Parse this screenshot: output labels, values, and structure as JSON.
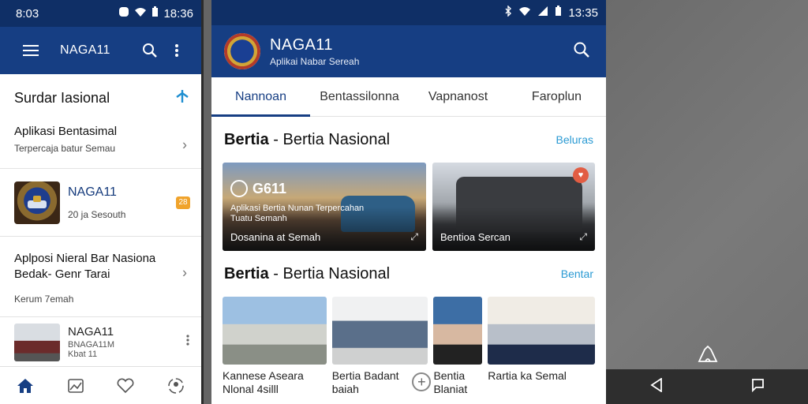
{
  "left": {
    "status_time": "8:03",
    "status_battery": "18:36",
    "app_title": "NAGA11",
    "section_title": "Surdar Iasional",
    "items": [
      {
        "title": "Aplikasi Bentasimal",
        "subtitle": "Terpercaja batur Semau"
      },
      {
        "title": "NAGA11",
        "subtitle": "20 ja Sesouth",
        "badge": "28"
      },
      {
        "title": "Aplposi Nieral Bar Nasiona Bedak- Genr Tarai",
        "subtitle": "Kerum 7emah"
      },
      {
        "title": "NAGA11",
        "line2": "BNAGA11M",
        "line3": "Kbat 11"
      }
    ]
  },
  "right": {
    "status_time": "13:35",
    "app_title": "NAGA11",
    "app_subtitle": "Aplikai Nabar Sereah",
    "tabs": [
      "Nannoan",
      "Bentassilonna",
      "Vapnanost",
      "Faroplun"
    ],
    "section1": {
      "bold": "Bertia",
      "rest": " - Bertia Nasional",
      "more": "Beluras"
    },
    "card1": {
      "logo": "G611",
      "subtitle": "Aplikasi Bertia Nunan Terpercahan Tuatu Semanh",
      "caption": "Dosanina at Semah"
    },
    "card2": {
      "caption": "Bentioa Sercan"
    },
    "section2": {
      "bold": "Bertia",
      "rest": " - Bertia Nasional",
      "more": "Bentar"
    },
    "thumbs": [
      {
        "caption": "Kannese Aseara Nlonal 4silll"
      },
      {
        "caption": "Bertia Badant baiah"
      },
      {
        "caption": "Bentia Blaniat"
      },
      {
        "caption": "Rartia ka Semal"
      }
    ]
  }
}
